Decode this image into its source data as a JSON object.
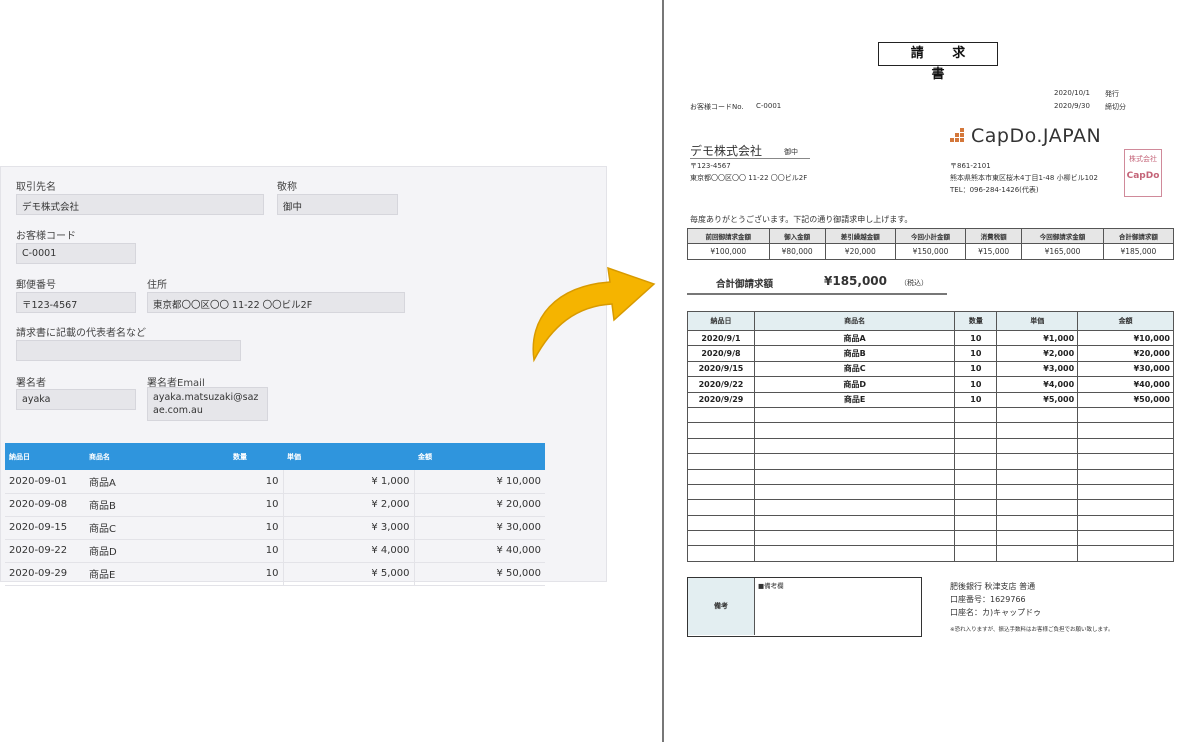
{
  "form": {
    "client_name_label": "取引先名",
    "client_name_value": "デモ株式会社",
    "honorific_label": "敬称",
    "honorific_value": "御中",
    "customer_code_label": "お客様コード",
    "customer_code_value": "C-0001",
    "postal_label": "郵便番号",
    "postal_value": "〒123-4567",
    "address_label": "住所",
    "address_value": "東京都〇〇区〇〇 11-22 〇〇ビル2F",
    "representative_label": "請求書に記載の代表者名など",
    "representative_value": "",
    "signer_label": "署名者",
    "signer_value": "ayaka",
    "signer_email_label": "署名者Email",
    "signer_email_value": "ayaka.matsuzaki@sazae.com.au",
    "table": {
      "headers": [
        "納品日",
        "商品名",
        "数量",
        "単価",
        "金額"
      ],
      "rows": [
        [
          "2020-09-01",
          "商品A",
          "10",
          "¥ 1,000",
          "¥ 10,000"
        ],
        [
          "2020-09-08",
          "商品B",
          "10",
          "¥ 2,000",
          "¥ 20,000"
        ],
        [
          "2020-09-15",
          "商品C",
          "10",
          "¥ 3,000",
          "¥ 30,000"
        ],
        [
          "2020-09-22",
          "商品D",
          "10",
          "¥ 4,000",
          "¥ 40,000"
        ],
        [
          "2020-09-29",
          "商品E",
          "10",
          "¥ 5,000",
          "¥ 50,000"
        ]
      ]
    }
  },
  "arrow_color": "#f5b400",
  "invoice": {
    "title": "請 求 書",
    "issue_date": "2020/10/1",
    "issue_label": "発行",
    "due_date": "2020/9/30",
    "due_label": "締切分",
    "customer_code_label": "お客様コードNo.",
    "customer_code": "C-0001",
    "client_name": "デモ株式会社",
    "client_honorific": "御中",
    "client_postal": "〒123-4567",
    "client_address": "東京都〇〇区〇〇 11-22 〇〇ビル2F",
    "logo_text": "CapDo.JAPAN",
    "logo_color": "#d4773a",
    "company_postal": "〒861-2101",
    "company_address": "熊本県熊本市東区桜木4丁目1-48 小柳ビル102",
    "company_tel": "TEL：096-284-1426(代表)",
    "seal_top": "株式会社",
    "seal_main": "CapDo",
    "greeting": "毎度ありがとうございます。下記の通り御請求申し上げます。",
    "summary": {
      "headers": [
        "前回御請求金額",
        "御入金額",
        "差引繰越金額",
        "今回小計金額",
        "消費税額",
        "今回御請求金額",
        "合計御請求額"
      ],
      "values": [
        "¥100,000",
        "¥80,000",
        "¥20,000",
        "¥150,000",
        "¥15,000",
        "¥165,000",
        "¥185,000"
      ]
    },
    "total_label": "合計御請求額",
    "total_value": "¥185,000",
    "total_tax_note": "（税込）",
    "detail": {
      "headers": [
        "納品日",
        "商品名",
        "数量",
        "単価",
        "金額"
      ],
      "rows": [
        [
          "2020/9/1",
          "商品A",
          "10",
          "¥1,000",
          "¥10,000"
        ],
        [
          "2020/9/8",
          "商品B",
          "10",
          "¥2,000",
          "¥20,000"
        ],
        [
          "2020/9/15",
          "商品C",
          "10",
          "¥3,000",
          "¥30,000"
        ],
        [
          "2020/9/22",
          "商品D",
          "10",
          "¥4,000",
          "¥40,000"
        ],
        [
          "2020/9/29",
          "商品E",
          "10",
          "¥5,000",
          "¥50,000"
        ]
      ],
      "empty_rows": 10
    },
    "remarks_head": "備考",
    "remarks_label": "■備考欄",
    "bank_name": "肥後銀行 秋津支店 普通",
    "bank_account": "口座番号：1629766",
    "bank_holder": "口座名：カ)キャップドゥ",
    "bank_note": "※恐れ入りますが、振込手数料はお客様ご負担でお願い致します。"
  }
}
